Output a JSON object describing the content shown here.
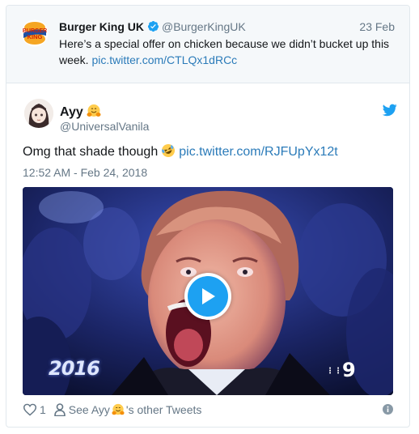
{
  "parent_tweet": {
    "author_name": "Burger King UK",
    "handle": "@BurgerKingUK",
    "date": "23 Feb",
    "text": "Here’s a special offer on chicken because we didn’t bucket up this week.",
    "link": "pic.twitter.com/CTLQx1dRCc",
    "logo_text_top": "BURGER",
    "logo_text_bottom": "KING"
  },
  "tweet": {
    "author_name": "Ayy",
    "handle": "@UniversalVanila",
    "text": "Omg that shade though",
    "link": "pic.twitter.com/RJFUpYx12t",
    "timestamp": "12:52 AM - Feb 24, 2018",
    "media_overlay_year": "2016",
    "media_overlay_channel": "9"
  },
  "footer": {
    "like_count": "1",
    "see_prefix": "See Ayy",
    "see_suffix": "'s other Tweets"
  },
  "icons": {
    "verified": "verified-badge-icon",
    "twitter": "twitter-bird-icon",
    "play": "play-icon",
    "heart": "heart-icon",
    "person": "person-icon",
    "info": "info-icon",
    "hug_emoji": "hugging-face-emoji",
    "laugh_emoji": "rolling-laughing-emoji"
  },
  "colors": {
    "link": "#2b7bb9",
    "twitter_blue": "#1da1f2",
    "muted": "#657786",
    "parent_bg": "#f5f8fa",
    "border": "#e1e8ed"
  }
}
